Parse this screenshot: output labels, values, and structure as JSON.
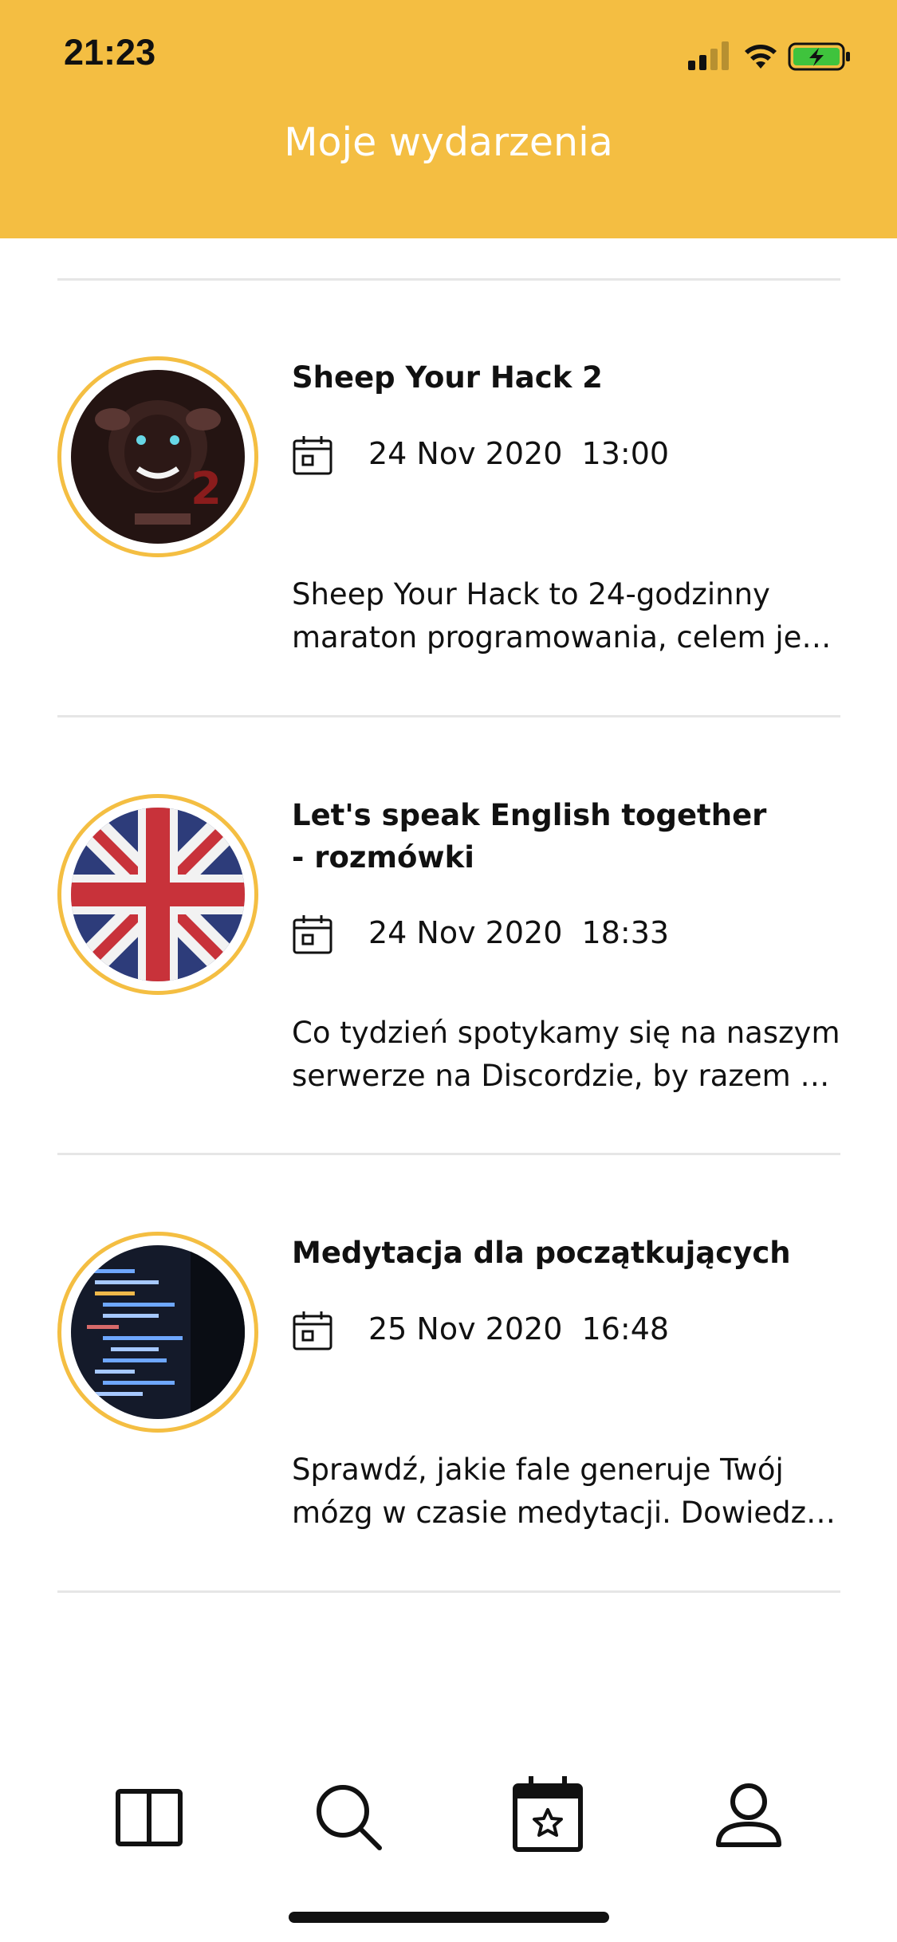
{
  "status_bar": {
    "time": "21:23",
    "signal_icon": "cellular-signal-icon",
    "wifi_icon": "wifi-icon",
    "battery_icon": "battery-charging-icon"
  },
  "header": {
    "title": "Moje wydarzenia",
    "background_color": "#F4BE42"
  },
  "events": [
    {
      "title": "Sheep Your Hack 2",
      "date": "24 Nov 2020  13:00",
      "description_lines": [
        "Sheep Your Hack to 24-godzinny",
        "maraton programowania, celem jest s..."
      ],
      "image_icon": "sheep-hackathon-logo"
    },
    {
      "title": "Let's speak English together\n- rozmówki",
      "date": "24 Nov 2020  18:33",
      "description_lines": [
        "Co tydzień spotykamy się na naszym",
        "serwerze na Discordzie, by razem dos..."
      ],
      "image_icon": "union-jack-flag"
    },
    {
      "title": "Medytacja dla początkujących",
      "date": "25 Nov 2020  16:48",
      "description_lines": [
        "Sprawdź, jakie fale generuje Twój",
        "mózg w czasie medytacji. Dowiedz si..."
      ],
      "image_icon": "code-screen-photo"
    }
  ],
  "tab_bar": {
    "tabs": [
      {
        "icon": "book-icon"
      },
      {
        "icon": "search-icon"
      },
      {
        "icon": "calendar-star-icon",
        "active": true
      },
      {
        "icon": "profile-icon"
      }
    ]
  },
  "colors": {
    "accent": "#F4BE42",
    "text": "#111111",
    "divider": "#E6E6E6"
  }
}
